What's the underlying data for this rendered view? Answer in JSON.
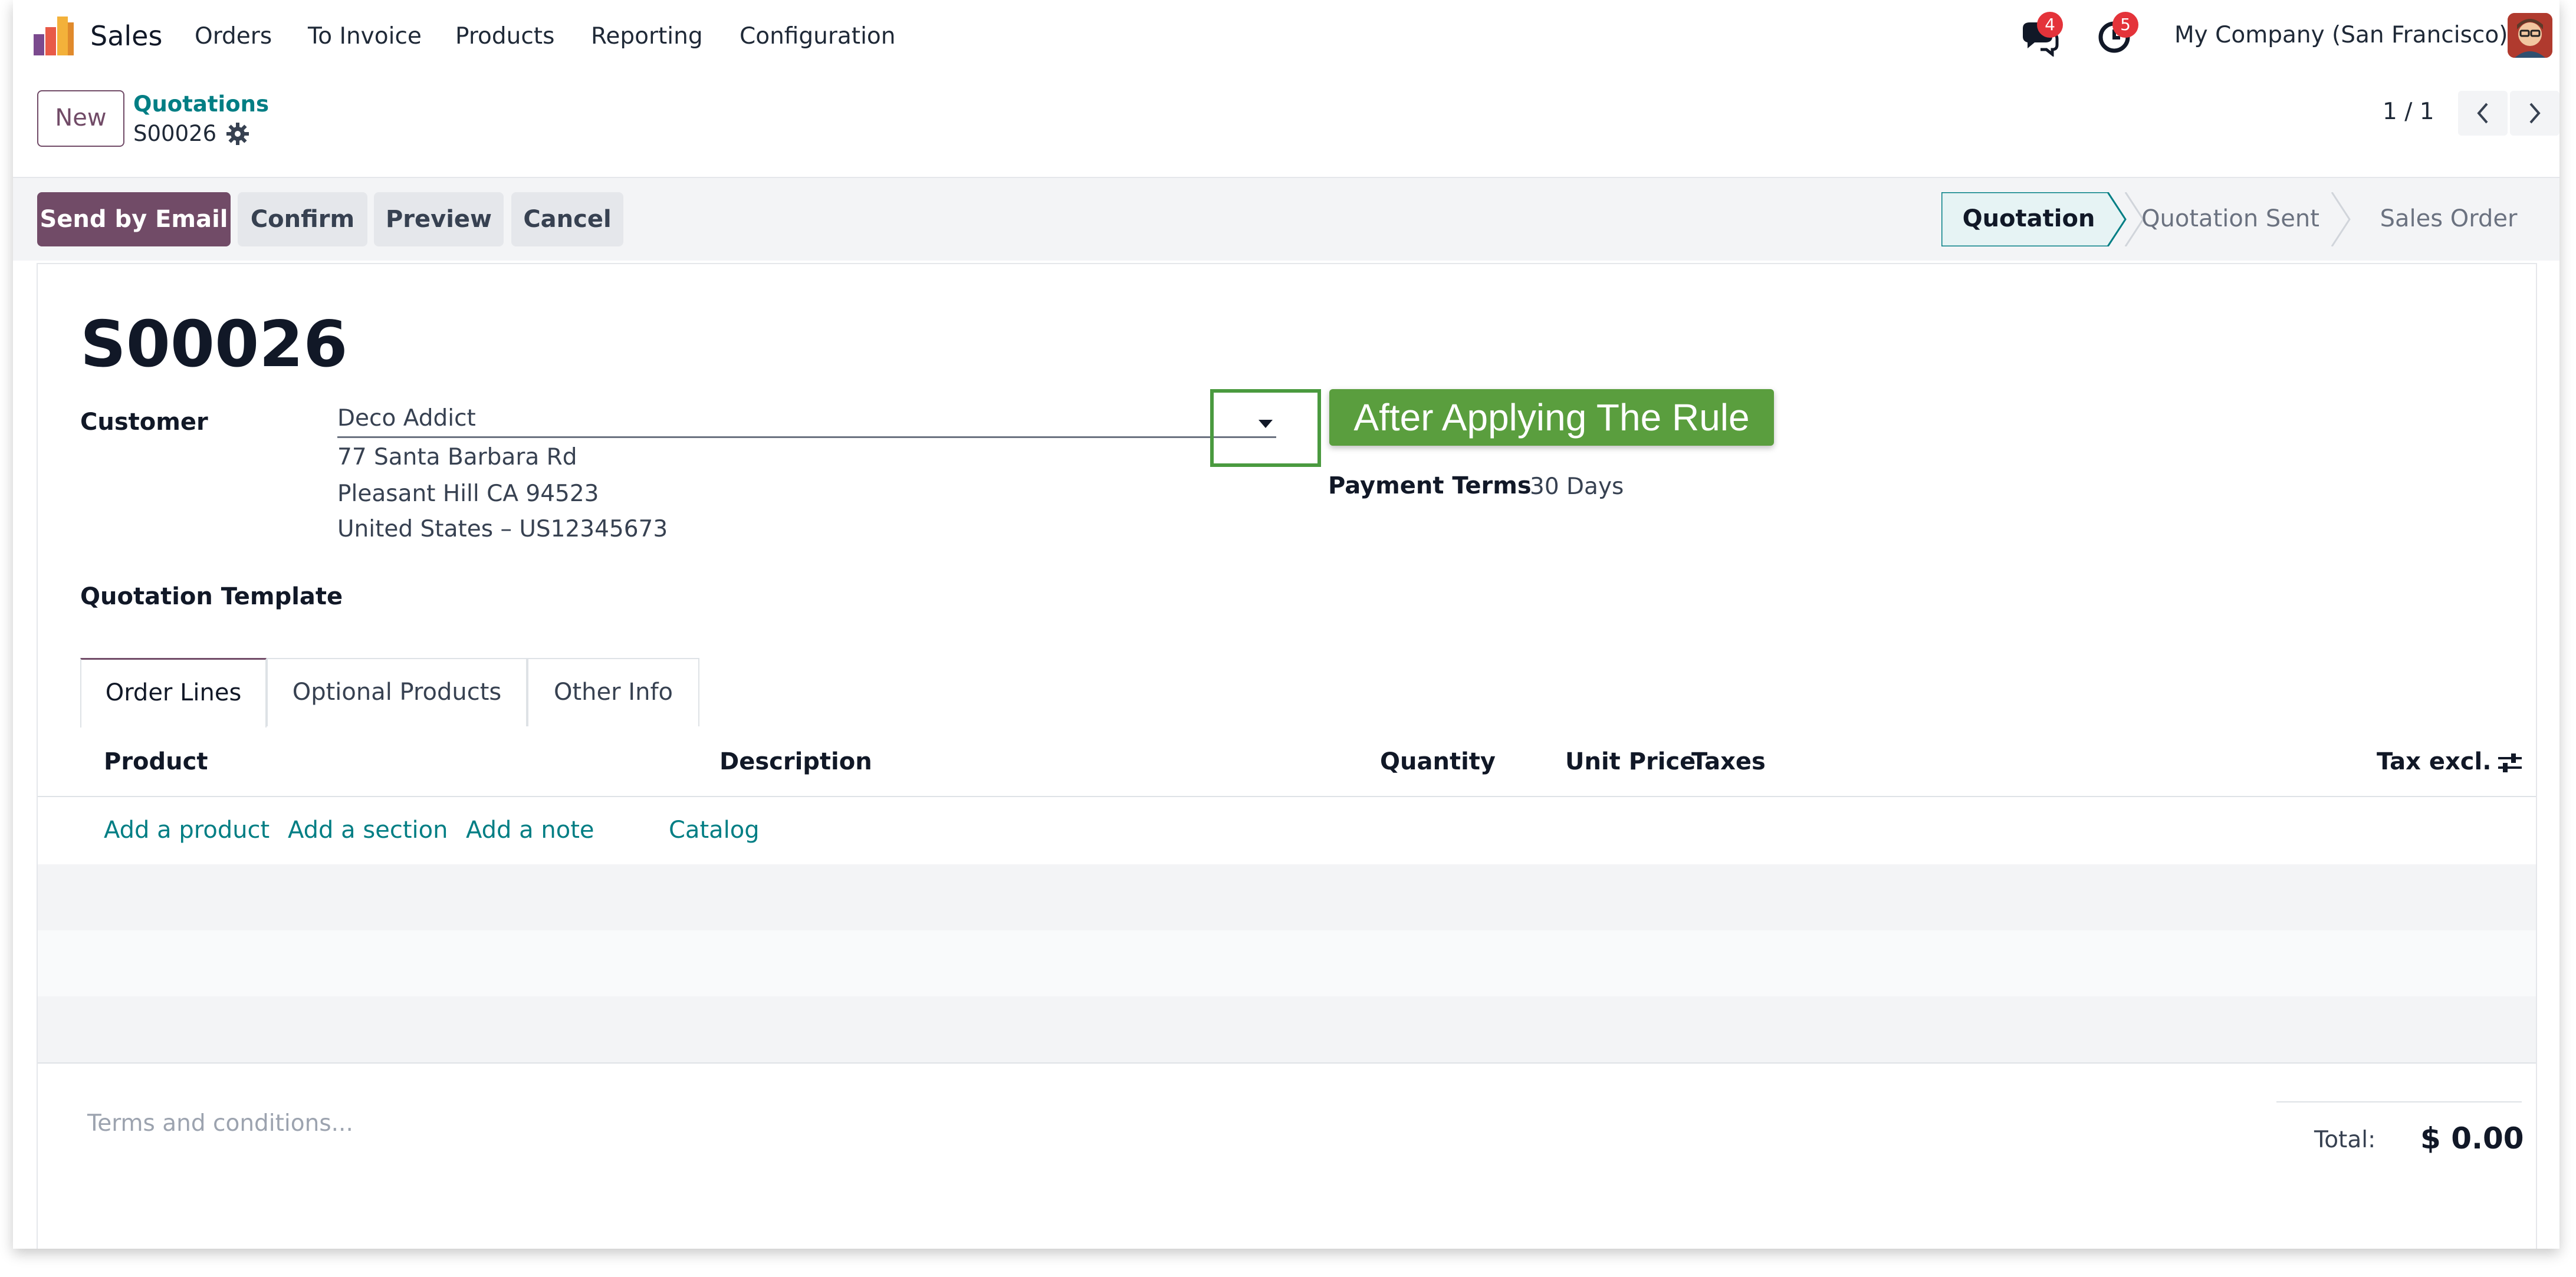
{
  "navbar": {
    "app_name": "Sales",
    "menu": [
      "Orders",
      "To Invoice",
      "Products",
      "Reporting",
      "Configuration"
    ],
    "messages_badge": "4",
    "activities_badge": "5",
    "company": "My Company (San Francisco)"
  },
  "control_panel": {
    "new_label": "New",
    "breadcrumb_parent": "Quotations",
    "record_name": "S00026",
    "pager": "1 / 1"
  },
  "actions": {
    "send_email": "Send by Email",
    "confirm": "Confirm",
    "preview": "Preview",
    "cancel": "Cancel"
  },
  "status_steps": [
    "Quotation",
    "Quotation Sent",
    "Sales Order"
  ],
  "status_active": "Quotation",
  "form": {
    "title": "S00026",
    "customer_label": "Customer",
    "customer_value": "Deco Addict",
    "address_line1": "77 Santa Barbara Rd",
    "address_line2": "Pleasant Hill CA 94523",
    "address_line3": "United States – US12345673",
    "payment_terms_label": "Payment Terms",
    "payment_terms_value": "30 Days",
    "quotation_template_label": "Quotation Template",
    "annotation": "After Applying The Rule"
  },
  "tabs": [
    "Order Lines",
    "Optional Products",
    "Other Info"
  ],
  "table": {
    "headers": {
      "product": "Product",
      "description": "Description",
      "quantity": "Quantity",
      "unit_price": "Unit Price",
      "taxes": "Taxes",
      "tax_excl": "Tax excl."
    },
    "add_links": [
      "Add a product",
      "Add a section",
      "Add a note",
      "Catalog"
    ]
  },
  "footer": {
    "terms_placeholder": "Terms and conditions...",
    "total_label": "Total:",
    "total_value": "$ 0.00"
  },
  "colors": {
    "brand": "#714b67",
    "link": "#017e84",
    "badge": "#e4333a",
    "annotation": "#5a9e3e"
  }
}
